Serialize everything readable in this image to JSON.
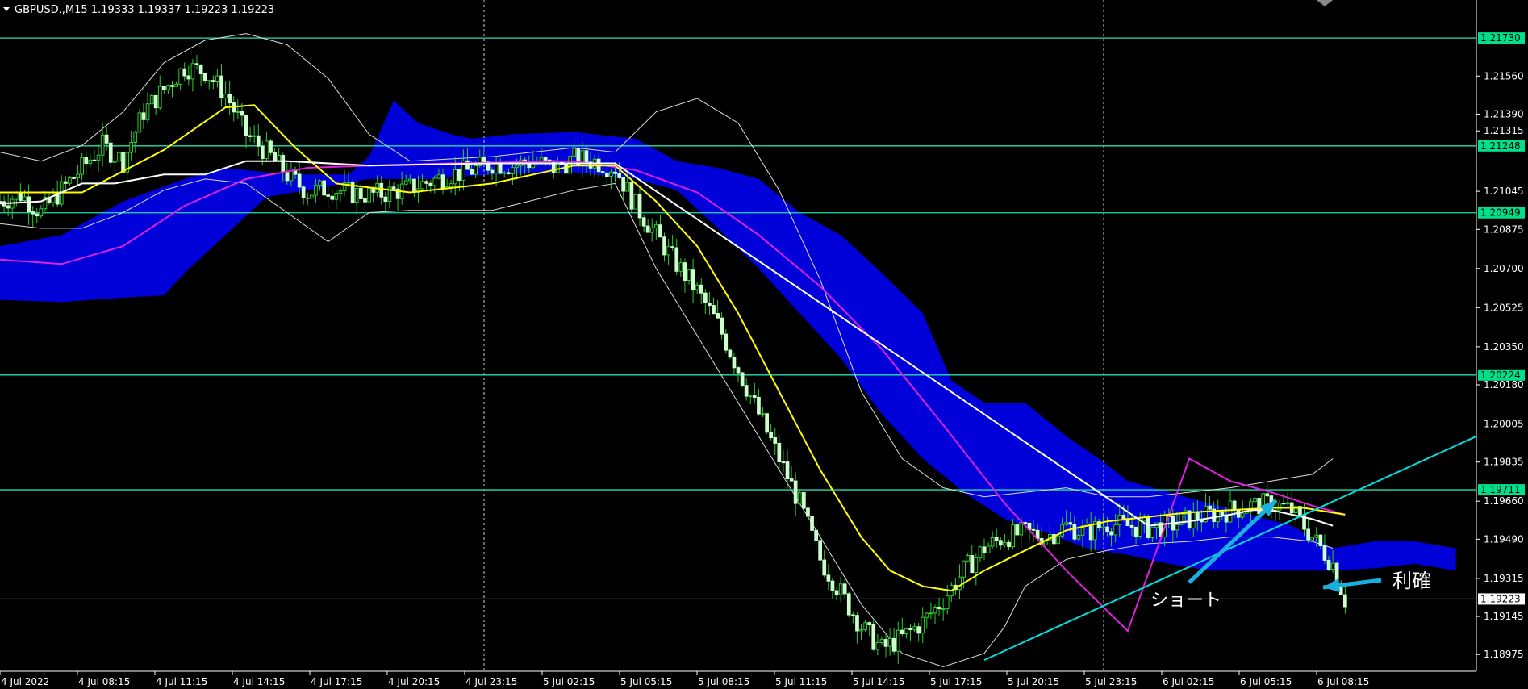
{
  "header": {
    "symbol_title": "GBPUSD.,M15",
    "ohlc": "1.19333 1.19337 1.19223 1.19223"
  },
  "colors": {
    "background": "#000000",
    "cloud": "#0000d8",
    "candle": "#ccffcc",
    "level_line": "#20e0b0",
    "level_label_bg": "#00e08a",
    "ma_yellow": "#ffff00",
    "ma_magenta": "#e020e0",
    "bollinger": "#dddddd",
    "conversion_white": "#ffffff",
    "trend_cyan": "#00e0e0",
    "arrow": "#19b0e0",
    "current_line": "#b0b0b0"
  },
  "annotations": {
    "short_label": "ショート",
    "profit_label": "利確"
  },
  "chart_data": {
    "type": "candlestick",
    "symbol": "GBPUSD.",
    "timeframe": "M15",
    "ylim": [
      1.189,
      1.219
    ],
    "yticks": [
      "1.21730",
      "1.21560",
      "1.21390",
      "1.21248",
      "1.21315",
      "1.21045",
      "1.20875",
      "1.20700",
      "1.20525",
      "1.20350",
      "1.20224",
      "1.20180",
      "1.20005",
      "1.19835",
      "1.19711",
      "1.19660",
      "1.19490",
      "1.19315",
      "1.19223",
      "1.19145",
      "1.18975"
    ],
    "ytick_values": [
      1.2173,
      1.2156,
      1.2139,
      1.21248,
      1.21315,
      1.21045,
      1.20875,
      1.207,
      1.20525,
      1.2035,
      1.20224,
      1.2018,
      1.20005,
      1.19835,
      1.19711,
      1.1966,
      1.1949,
      1.19315,
      1.19223,
      1.19145,
      1.18975
    ],
    "highlighted_levels": [
      {
        "label": "1.21730",
        "value": 1.2173
      },
      {
        "label": "1.21248",
        "value": 1.21248
      },
      {
        "label": "1.20949",
        "value": 1.20949
      },
      {
        "label": "1.20224",
        "value": 1.20224
      },
      {
        "label": "1.19711",
        "value": 1.19711
      }
    ],
    "current_price": {
      "label": "1.19223",
      "value": 1.19223
    },
    "xticks": [
      "4 Jul 2022",
      "4 Jul 08:15",
      "4 Jul 11:15",
      "4 Jul 14:15",
      "4 Jul 17:15",
      "4 Jul 20:15",
      "4 Jul 23:15",
      "5 Jul 02:15",
      "5 Jul 05:15",
      "5 Jul 08:15",
      "5 Jul 11:15",
      "5 Jul 14:15",
      "5 Jul 17:15",
      "5 Jul 20:15",
      "5 Jul 23:15",
      "6 Jul 02:15",
      "6 Jul 05:15",
      "6 Jul 08:15"
    ],
    "close_path": [
      [
        0,
        1.21
      ],
      [
        5,
        1.2103
      ],
      [
        10,
        1.2095
      ],
      [
        15,
        1.2105
      ],
      [
        20,
        1.2115
      ],
      [
        25,
        1.2125
      ],
      [
        30,
        1.2118
      ],
      [
        35,
        1.214
      ],
      [
        40,
        1.215
      ],
      [
        45,
        1.216
      ],
      [
        50,
        1.2158
      ],
      [
        55,
        1.2148
      ],
      [
        60,
        1.213
      ],
      [
        65,
        1.2122
      ],
      [
        70,
        1.2112
      ],
      [
        75,
        1.2104
      ],
      [
        80,
        1.2106
      ],
      [
        85,
        1.2104
      ],
      [
        90,
        1.2103
      ],
      [
        95,
        1.2104
      ],
      [
        100,
        1.2106
      ],
      [
        105,
        1.2109
      ],
      [
        110,
        1.2112
      ],
      [
        115,
        1.2114
      ],
      [
        120,
        1.2117
      ],
      [
        125,
        1.2116
      ],
      [
        130,
        1.2118
      ],
      [
        135,
        1.2115
      ],
      [
        140,
        1.2119
      ],
      [
        145,
        1.2118
      ],
      [
        150,
        1.2115
      ],
      [
        155,
        1.2098
      ],
      [
        160,
        1.2085
      ],
      [
        165,
        1.2072
      ],
      [
        170,
        1.206
      ],
      [
        175,
        1.2045
      ],
      [
        180,
        1.2025
      ],
      [
        185,
        1.2005
      ],
      [
        190,
        1.1985
      ],
      [
        195,
        1.1965
      ],
      [
        200,
        1.194
      ],
      [
        205,
        1.1925
      ],
      [
        210,
        1.191
      ],
      [
        215,
        1.19
      ],
      [
        220,
        1.1905
      ],
      [
        225,
        1.1912
      ],
      [
        230,
        1.1922
      ],
      [
        235,
        1.1935
      ],
      [
        240,
        1.1945
      ],
      [
        245,
        1.195
      ],
      [
        250,
        1.1952
      ],
      [
        255,
        1.195
      ],
      [
        260,
        1.1955
      ],
      [
        265,
        1.1952
      ],
      [
        270,
        1.1956
      ],
      [
        275,
        1.1955
      ],
      [
        280,
        1.1954
      ],
      [
        285,
        1.1955
      ],
      [
        290,
        1.1958
      ],
      [
        295,
        1.196
      ],
      [
        300,
        1.1962
      ],
      [
        305,
        1.1964
      ],
      [
        310,
        1.1965
      ],
      [
        315,
        1.1962
      ],
      [
        320,
        1.195
      ],
      [
        325,
        1.1938
      ],
      [
        328,
        1.1922
      ]
    ],
    "ma_yellow": [
      [
        0,
        1.2104
      ],
      [
        20,
        1.2104
      ],
      [
        40,
        1.2123
      ],
      [
        55,
        1.2142
      ],
      [
        62,
        1.2143
      ],
      [
        72,
        1.2124
      ],
      [
        82,
        1.2108
      ],
      [
        100,
        1.2104
      ],
      [
        120,
        1.2108
      ],
      [
        140,
        1.2116
      ],
      [
        150,
        1.2116
      ],
      [
        160,
        1.21
      ],
      [
        170,
        1.208
      ],
      [
        180,
        1.205
      ],
      [
        190,
        1.2015
      ],
      [
        200,
        1.198
      ],
      [
        210,
        1.195
      ],
      [
        217,
        1.1935
      ],
      [
        225,
        1.1928
      ],
      [
        232,
        1.1926
      ],
      [
        240,
        1.1935
      ],
      [
        250,
        1.1944
      ],
      [
        260,
        1.1953
      ],
      [
        270,
        1.1957
      ],
      [
        280,
        1.1959
      ],
      [
        290,
        1.1961
      ],
      [
        300,
        1.1962
      ],
      [
        310,
        1.1963
      ],
      [
        318,
        1.1963
      ],
      [
        328,
        1.196
      ]
    ],
    "ma_magenta": [
      [
        0,
        1.2074
      ],
      [
        15,
        1.2072
      ],
      [
        30,
        1.208
      ],
      [
        45,
        1.2098
      ],
      [
        60,
        1.211
      ],
      [
        75,
        1.2115
      ],
      [
        90,
        1.2116
      ],
      [
        110,
        1.2117
      ],
      [
        140,
        1.2118
      ],
      [
        155,
        1.2114
      ],
      [
        170,
        1.2104
      ],
      [
        185,
        1.2085
      ],
      [
        200,
        1.2062
      ],
      [
        215,
        1.2034
      ],
      [
        230,
        1.2
      ],
      [
        245,
        1.1965
      ],
      [
        260,
        1.1935
      ],
      [
        275,
        1.1908
      ],
      [
        290,
        1.1985
      ],
      [
        300,
        1.1975
      ],
      [
        310,
        1.197
      ],
      [
        320,
        1.1964
      ],
      [
        328,
        1.196
      ]
    ],
    "cloud_top": [
      [
        0,
        1.208
      ],
      [
        15,
        1.2085
      ],
      [
        30,
        1.21
      ],
      [
        45,
        1.211
      ],
      [
        55,
        1.2115
      ],
      [
        70,
        1.2112
      ],
      [
        85,
        1.2112
      ],
      [
        90,
        1.212
      ],
      [
        96,
        1.2145
      ],
      [
        102,
        1.2135
      ],
      [
        110,
        1.213
      ],
      [
        115,
        1.2128
      ],
      [
        125,
        1.213
      ],
      [
        140,
        1.2131
      ],
      [
        155,
        1.2128
      ],
      [
        165,
        1.2118
      ],
      [
        175,
        1.2115
      ],
      [
        185,
        1.211
      ],
      [
        195,
        1.2095
      ],
      [
        205,
        1.2085
      ],
      [
        215,
        1.2068
      ],
      [
        225,
        1.205
      ],
      [
        232,
        1.202
      ],
      [
        240,
        1.201
      ],
      [
        250,
        1.201
      ],
      [
        260,
        1.1995
      ],
      [
        268,
        1.1985
      ],
      [
        275,
        1.1975
      ],
      [
        285,
        1.197
      ],
      [
        295,
        1.1965
      ],
      [
        305,
        1.196
      ],
      [
        315,
        1.1955
      ],
      [
        325,
        1.1945
      ],
      [
        335,
        1.1948
      ],
      [
        345,
        1.1948
      ],
      [
        355,
        1.1945
      ]
    ],
    "cloud_bottom": [
      [
        0,
        1.2056
      ],
      [
        15,
        1.2055
      ],
      [
        30,
        1.2057
      ],
      [
        40,
        1.2058
      ],
      [
        45,
        1.2068
      ],
      [
        55,
        1.2085
      ],
      [
        65,
        1.2102
      ],
      [
        75,
        1.2105
      ],
      [
        90,
        1.211
      ],
      [
        105,
        1.211
      ],
      [
        120,
        1.2112
      ],
      [
        140,
        1.2113
      ],
      [
        155,
        1.211
      ],
      [
        165,
        1.2105
      ],
      [
        175,
        1.2088
      ],
      [
        185,
        1.207
      ],
      [
        195,
        1.205
      ],
      [
        205,
        1.203
      ],
      [
        215,
        1.2005
      ],
      [
        225,
        1.1985
      ],
      [
        235,
        1.197
      ],
      [
        245,
        1.1958
      ],
      [
        255,
        1.1952
      ],
      [
        265,
        1.1945
      ],
      [
        275,
        1.1942
      ],
      [
        285,
        1.1938
      ],
      [
        295,
        1.1935
      ],
      [
        305,
        1.1935
      ],
      [
        315,
        1.1935
      ],
      [
        325,
        1.1935
      ],
      [
        335,
        1.1936
      ],
      [
        345,
        1.1938
      ],
      [
        355,
        1.1935
      ]
    ],
    "bb_upper": [
      [
        0,
        1.2122
      ],
      [
        10,
        1.2118
      ],
      [
        20,
        1.2125
      ],
      [
        30,
        1.214
      ],
      [
        40,
        1.2162
      ],
      [
        50,
        1.2172
      ],
      [
        60,
        1.2175
      ],
      [
        70,
        1.217
      ],
      [
        80,
        1.2155
      ],
      [
        90,
        1.213
      ],
      [
        100,
        1.2118
      ],
      [
        120,
        1.212
      ],
      [
        140,
        1.2124
      ],
      [
        150,
        1.2122
      ],
      [
        160,
        1.214
      ],
      [
        170,
        1.2146
      ],
      [
        180,
        1.2135
      ],
      [
        190,
        1.2105
      ],
      [
        200,
        1.2065
      ],
      [
        210,
        1.2015
      ],
      [
        220,
        1.1985
      ],
      [
        230,
        1.1972
      ],
      [
        240,
        1.1968
      ],
      [
        250,
        1.197
      ],
      [
        260,
        1.1972
      ],
      [
        270,
        1.1968
      ],
      [
        280,
        1.1968
      ],
      [
        290,
        1.197
      ],
      [
        300,
        1.1972
      ],
      [
        310,
        1.1975
      ],
      [
        320,
        1.1978
      ],
      [
        325,
        1.1985
      ]
    ],
    "bb_lower": [
      [
        0,
        1.209
      ],
      [
        10,
        1.2088
      ],
      [
        20,
        1.2088
      ],
      [
        30,
        1.2095
      ],
      [
        40,
        1.2105
      ],
      [
        50,
        1.211
      ],
      [
        60,
        1.2108
      ],
      [
        70,
        1.2095
      ],
      [
        80,
        1.2082
      ],
      [
        90,
        1.2095
      ],
      [
        100,
        1.2096
      ],
      [
        120,
        1.2096
      ],
      [
        140,
        1.2105
      ],
      [
        150,
        1.2108
      ],
      [
        160,
        1.207
      ],
      [
        170,
        1.204
      ],
      [
        180,
        1.201
      ],
      [
        190,
        1.198
      ],
      [
        200,
        1.195
      ],
      [
        210,
        1.192
      ],
      [
        220,
        1.1898
      ],
      [
        230,
        1.1892
      ],
      [
        240,
        1.1898
      ],
      [
        245,
        1.191
      ],
      [
        250,
        1.1928
      ],
      [
        260,
        1.194
      ],
      [
        270,
        1.1944
      ],
      [
        280,
        1.1947
      ],
      [
        290,
        1.1948
      ],
      [
        300,
        1.195
      ],
      [
        310,
        1.195
      ],
      [
        320,
        1.1948
      ],
      [
        325,
        1.1945
      ]
    ],
    "conversion_white": [
      [
        0,
        1.2099
      ],
      [
        10,
        1.21
      ],
      [
        20,
        1.2108
      ],
      [
        28,
        1.2108
      ],
      [
        40,
        1.2112
      ],
      [
        50,
        1.2112
      ],
      [
        60,
        1.2118
      ],
      [
        70,
        1.2118
      ],
      [
        90,
        1.2116
      ],
      [
        120,
        1.2117
      ],
      [
        150,
        1.2117
      ],
      [
        280,
        1.1955
      ],
      [
        290,
        1.1957
      ],
      [
        300,
        1.196
      ],
      [
        305,
        1.1962
      ],
      [
        310,
        1.1962
      ],
      [
        315,
        1.196
      ],
      [
        320,
        1.1958
      ],
      [
        325,
        1.1955
      ]
    ],
    "trend_line": [
      [
        240,
        1.1895
      ],
      [
        360,
        1.1995
      ]
    ]
  }
}
